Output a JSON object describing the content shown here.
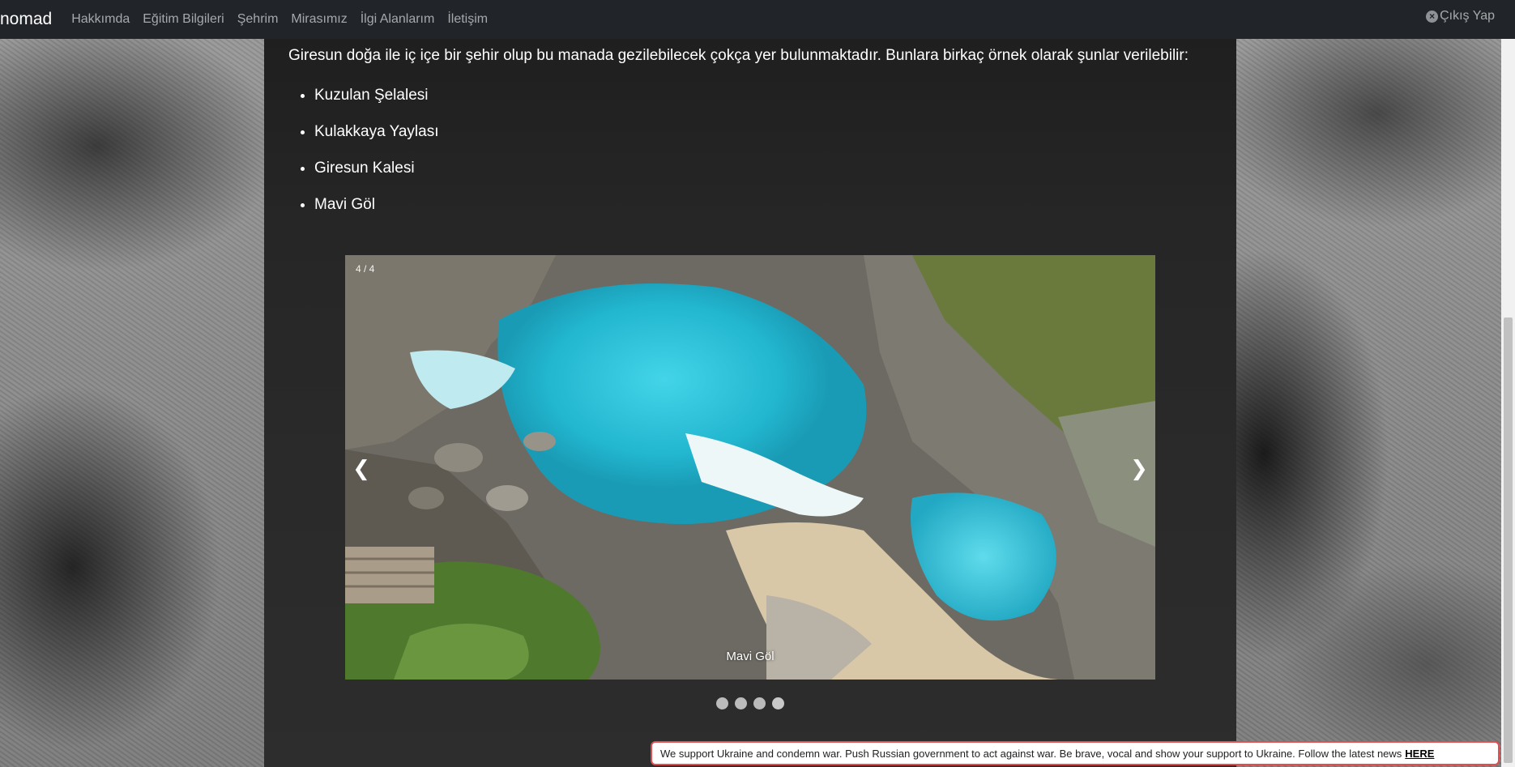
{
  "navbar": {
    "brand": "nomad",
    "links": [
      "Hakkımda",
      "Eğitim Bilgileri",
      "Şehrim",
      "Mirasımız",
      "İlgi Alanlarım",
      "İletişim"
    ],
    "logout_label": "Çıkış Yap",
    "logout_icon": "close-circle-icon"
  },
  "main": {
    "intro": "Giresun doğa ile iç içe bir şehir olup bu manada gezilebilecek çokça yer bulunmaktadır. Bunlara birkaç örnek olarak şunlar verilebilir:",
    "places": [
      "Kuzulan Şelalesi",
      "Kulakkaya Yaylası",
      "Giresun Kalesi",
      "Mavi Göl"
    ]
  },
  "carousel": {
    "counter": "4 / 4",
    "caption": "Mavi Göl",
    "prev_icon": "❮",
    "next_icon": "❯",
    "slide_count": 4,
    "active_index": 3,
    "water_color": "#3fc8dc"
  },
  "banner": {
    "text": "We support Ukraine and condemn war. Push Russian government to act against war. Be brave, vocal and show your support to Ukraine. Follow the latest news",
    "link": "HERE",
    "border_color": "#e05050"
  }
}
